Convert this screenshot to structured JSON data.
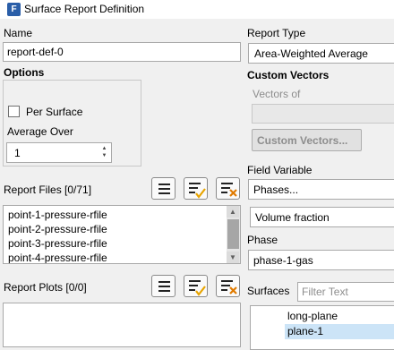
{
  "window": {
    "title": "Surface Report Definition",
    "app_icon": "F"
  },
  "name": {
    "label": "Name",
    "value": "report-def-0"
  },
  "options": {
    "label": "Options",
    "per_surface_label": "Per Surface",
    "average_over_label": "Average Over",
    "average_over_value": "1"
  },
  "report_files": {
    "label": "Report Files [0/71]",
    "items": [
      "point-1-pressure-rfile",
      "point-2-pressure-rfile",
      "point-3-pressure-rfile",
      "point-4-pressure-rfile"
    ]
  },
  "report_plots": {
    "label": "Report Plots [0/0]"
  },
  "report_type": {
    "label": "Report Type",
    "value": "Area-Weighted Average"
  },
  "custom_vectors": {
    "label": "Custom Vectors",
    "vectors_of_label": "Vectors of",
    "button_label": "Custom Vectors..."
  },
  "field_variable": {
    "label": "Field Variable",
    "category": "Phases...",
    "value": "Volume fraction"
  },
  "phase": {
    "label": "Phase",
    "value": "phase-1-gas"
  },
  "surfaces": {
    "label": "Surfaces",
    "filter_placeholder": "Filter Text",
    "items": [
      "long-plane",
      "plane-1"
    ]
  },
  "colors": {
    "accent_check": "#e8a400",
    "accent_x": "#e07a00",
    "selected_row": "#cce4f7"
  },
  "icons": [
    "list-icon",
    "list-check-icon",
    "list-clear-icon"
  ]
}
